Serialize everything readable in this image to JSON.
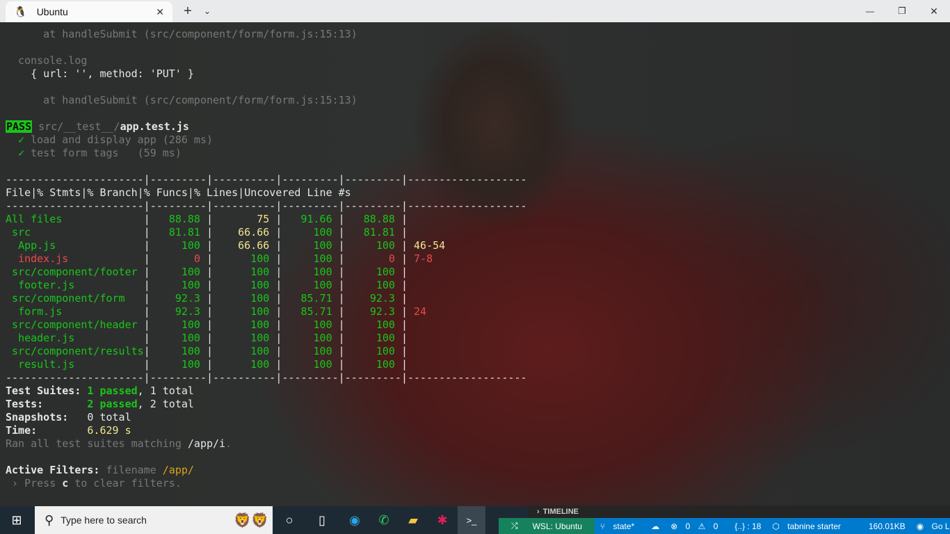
{
  "window": {
    "tab_title": "Ubuntu",
    "new_tab": "+",
    "dropdown": "⌄",
    "minimize": "—",
    "maximize": "❐",
    "close": "✕",
    "tab_close": "✕"
  },
  "terminal": {
    "log1": "      at handleSubmit (src/component/form/form.js:15:13)",
    "console_log": "  console.log",
    "obj": "    { url: '', method: 'PUT' }",
    "log2": "      at handleSubmit (src/component/form/form.js:15:13)",
    "pass_badge": "PASS",
    "test_path": "src/__test__/",
    "test_file": "app.test.js",
    "tests": [
      {
        "check": "✓",
        "name": "load and display app (286 ms)"
      },
      {
        "check": "✓",
        "name": "test form tags   (59 ms)"
      }
    ],
    "coverage": {
      "separator": "----------------------|---------|----------|---------|---------|-------------------",
      "headers": [
        "File",
        "% Stmts",
        "% Branch",
        "% Funcs",
        "% Lines",
        "Uncovered Line #s"
      ],
      "rows": [
        {
          "file": "All files",
          "indent": 0,
          "stmts": "88.88",
          "branch": "75",
          "funcs": "91.66",
          "lines": "88.88",
          "uncovered": "",
          "uncovered_color": ""
        },
        {
          "file": "src",
          "indent": 1,
          "stmts": "81.81",
          "branch": "66.66",
          "funcs": "100",
          "lines": "81.81",
          "uncovered": "",
          "uncovered_color": ""
        },
        {
          "file": "App.js",
          "indent": 2,
          "stmts": "100",
          "branch": "66.66",
          "funcs": "100",
          "lines": "100",
          "uncovered": "46-54",
          "uncovered_color": "yellow"
        },
        {
          "file": "index.js",
          "indent": 2,
          "stmts": "0",
          "branch": "100",
          "funcs": "100",
          "lines": "0",
          "uncovered": "7-8",
          "uncovered_color": "red"
        },
        {
          "file": "src/component/footer",
          "indent": 1,
          "stmts": "100",
          "branch": "100",
          "funcs": "100",
          "lines": "100",
          "uncovered": "",
          "uncovered_color": ""
        },
        {
          "file": "footer.js",
          "indent": 2,
          "stmts": "100",
          "branch": "100",
          "funcs": "100",
          "lines": "100",
          "uncovered": "",
          "uncovered_color": ""
        },
        {
          "file": "src/component/form",
          "indent": 1,
          "stmts": "92.3",
          "branch": "100",
          "funcs": "85.71",
          "lines": "92.3",
          "uncovered": "",
          "uncovered_color": ""
        },
        {
          "file": "form.js",
          "indent": 2,
          "stmts": "92.3",
          "branch": "100",
          "funcs": "85.71",
          "lines": "92.3",
          "uncovered": "24",
          "uncovered_color": "red"
        },
        {
          "file": "src/component/header",
          "indent": 1,
          "stmts": "100",
          "branch": "100",
          "funcs": "100",
          "lines": "100",
          "uncovered": "",
          "uncovered_color": ""
        },
        {
          "file": "header.js",
          "indent": 2,
          "stmts": "100",
          "branch": "100",
          "funcs": "100",
          "lines": "100",
          "uncovered": "",
          "uncovered_color": ""
        },
        {
          "file": "src/component/results",
          "indent": 1,
          "stmts": "100",
          "branch": "100",
          "funcs": "100",
          "lines": "100",
          "uncovered": "",
          "uncovered_color": ""
        },
        {
          "file": "result.js",
          "indent": 2,
          "stmts": "100",
          "branch": "100",
          "funcs": "100",
          "lines": "100",
          "uncovered": "",
          "uncovered_color": ""
        }
      ]
    },
    "summary": {
      "suites_label": "Test Suites: ",
      "suites_passed": "1 passed",
      "suites_total": ", 1 total",
      "tests_label": "Tests:       ",
      "tests_passed": "2 passed",
      "tests_total": ", 2 total",
      "snap_label": "Snapshots:   ",
      "snap_value": "0 total",
      "time_label": "Time:        ",
      "time_value": "6.629 s",
      "ran_prefix": "Ran all test suites matching ",
      "ran_pattern": "/app/i",
      "ran_suffix": ".",
      "filters_label": "Active Filters: ",
      "filters_key": "filename ",
      "filters_value": "/app/",
      "press_prefix": " › Press ",
      "press_key": "c",
      "press_suffix": " to clear filters."
    }
  },
  "taskbar": {
    "search_placeholder": "Type here to search"
  },
  "vscode": {
    "timeline": "TIMELINE",
    "wsl": "WSL: Ubuntu",
    "branch": "state*",
    "errors": "0",
    "warnings": "0",
    "json": "{..} : 18",
    "tabnine": "tabnine starter",
    "size": "160.01KB",
    "golive": "Go Live"
  },
  "colors": {
    "pass": "#19c519",
    "green": "#19c519",
    "yellow": "#f3e58f",
    "red": "#e64b4b",
    "statusbar": "#007acc",
    "wsl": "#16825d"
  }
}
